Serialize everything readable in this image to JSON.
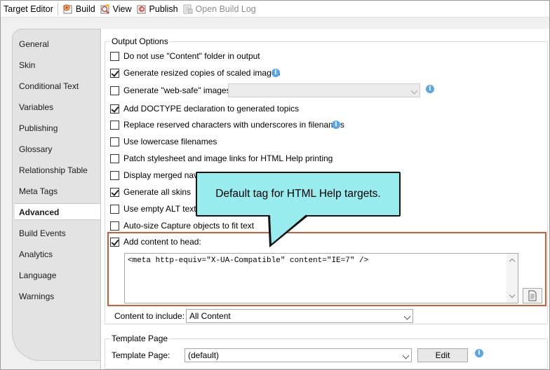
{
  "toolbar": {
    "title": "Target Editor",
    "build_label": "Build",
    "view_label": "View",
    "publish_label": "Publish",
    "open_build_log_label": "Open Build Log"
  },
  "tabs": [
    {
      "label": "General"
    },
    {
      "label": "Skin"
    },
    {
      "label": "Conditional Text"
    },
    {
      "label": "Variables"
    },
    {
      "label": "Publishing"
    },
    {
      "label": "Glossary"
    },
    {
      "label": "Relationship Table"
    },
    {
      "label": "Meta Tags"
    },
    {
      "label": "Advanced",
      "active": true
    },
    {
      "label": "Build Events"
    },
    {
      "label": "Analytics"
    },
    {
      "label": "Language"
    },
    {
      "label": "Warnings"
    }
  ],
  "output_options": {
    "title": "Output Options",
    "options": [
      {
        "label": "Do not use \"Content\" folder in output",
        "checked": false
      },
      {
        "label": "Generate resized copies of scaled images",
        "checked": true
      },
      {
        "label": "Generate \"web-safe\" images",
        "checked": false
      },
      {
        "label": "Add DOCTYPE declaration to generated topics",
        "checked": true
      },
      {
        "label": "Replace reserved characters with underscores in filenames",
        "checked": false
      },
      {
        "label": "Use lowercase filenames",
        "checked": false
      },
      {
        "label": "Patch stylesheet and image links for HTML Help printing",
        "checked": false
      },
      {
        "label": "Display merged navig",
        "checked": false
      },
      {
        "label": "Generate all skins",
        "checked": true
      },
      {
        "label": "Use empty ALT text fi",
        "checked": false
      },
      {
        "label": "Auto-size Capture objects to fit text",
        "checked": false
      },
      {
        "label": "Add content to head:",
        "checked": true
      }
    ],
    "web_safe_select_value": "",
    "head_content": "<meta http-equiv=\"X-UA-Compatible\" content=\"IE=7\" />",
    "content_to_include_label": "Content to include:",
    "content_to_include_value": "All Content"
  },
  "template_page": {
    "title": "Template Page",
    "label": "Template Page:",
    "value": "(default)",
    "edit_label": "Edit"
  },
  "callout": {
    "text": "Default tag for HTML Help targets."
  },
  "colors": {
    "callout_fill": "#99ecee",
    "highlight_border": "#d65a32",
    "info_icon": "#5aa5e6"
  }
}
